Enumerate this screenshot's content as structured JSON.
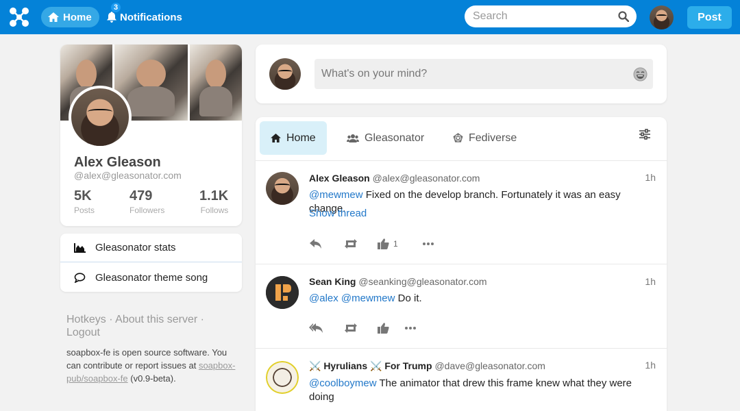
{
  "nav": {
    "home_label": "Home",
    "notifications_label": "Notifications",
    "notifications_count": "3",
    "search_placeholder": "Search",
    "post_label": "Post"
  },
  "profile": {
    "name": "Alex Gleason",
    "handle": "@alex@gleasonator.com",
    "stats": [
      {
        "value": "5K",
        "label": "Posts"
      },
      {
        "value": "479",
        "label": "Followers"
      },
      {
        "value": "1.1K",
        "label": "Follows"
      }
    ]
  },
  "links": [
    {
      "label": "Gleasonator stats",
      "icon": "chart-area-icon"
    },
    {
      "label": "Gleasonator theme song",
      "icon": "comment-icon"
    }
  ],
  "footer": {
    "hotkeys": "Hotkeys",
    "about": "About this server",
    "logout": "Logout",
    "sep": " · ",
    "text_before": "soapbox-fe is open source software. You can contribute or report issues at ",
    "repo": "soapbox-pub/soapbox-fe",
    "text_after": " (v0.9-beta)."
  },
  "composer": {
    "placeholder": "What's on your mind?"
  },
  "tabs": [
    {
      "label": "Home",
      "icon": "home-icon",
      "active": true
    },
    {
      "label": "Gleasonator",
      "icon": "users-icon",
      "active": false
    },
    {
      "label": "Fediverse",
      "icon": "fediverse-icon",
      "active": false
    }
  ],
  "statuses": [
    {
      "display_name": "Alex Gleason",
      "acct": "@alex@gleasonator.com",
      "time": "1h",
      "mentions": "@mewmew",
      "text": " Fixed on the develop branch. Fortunately it was an easy change.",
      "show_thread": "Show thread",
      "favourites": "1"
    },
    {
      "display_name": "Sean King",
      "acct": "@seanking@gleasonator.com",
      "time": "1h",
      "mentions": "@alex @mewmew",
      "text": " Do it."
    },
    {
      "display_name": "⚔️ Hyrulians ⚔️ For Trump",
      "acct": "@dave@gleasonator.com",
      "time": "1h",
      "mentions": "@coolboymew",
      "text": " The animator that drew this frame knew what they were doing"
    }
  ],
  "colors": {
    "brand": "#0482d8",
    "accent": "#2cadea",
    "link": "#2278c9",
    "active_tab": "#d9f0f9"
  }
}
